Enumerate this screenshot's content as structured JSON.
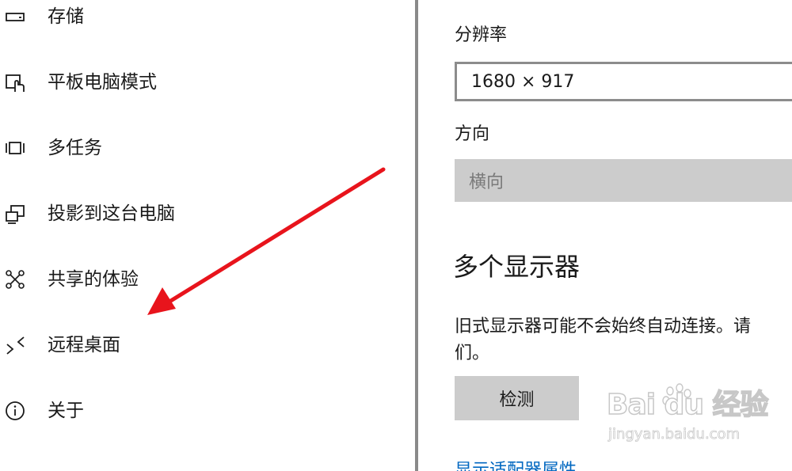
{
  "nav": {
    "items": [
      {
        "label": "存储",
        "icon": "storage-icon"
      },
      {
        "label": "平板电脑模式",
        "icon": "tablet-mode-icon"
      },
      {
        "label": "多任务",
        "icon": "multitasking-icon"
      },
      {
        "label": "投影到这台电脑",
        "icon": "project-to-pc-icon"
      },
      {
        "label": "共享的体验",
        "icon": "shared-experiences-icon"
      },
      {
        "label": "远程桌面",
        "icon": "remote-desktop-icon"
      },
      {
        "label": "关于",
        "icon": "info-icon"
      }
    ]
  },
  "display": {
    "resolution_label": "分辨率",
    "resolution_value": "1680 × 917",
    "orientation_label": "方向",
    "orientation_value": "横向",
    "multiple_displays_heading": "多个显示器",
    "multiple_displays_text_line1": "旧式显示器可能不会始终自动连接。请",
    "multiple_displays_text_line2": "们。",
    "detect_button": "检测",
    "adapter_link": "显示适配器属性"
  },
  "colors": {
    "annotation_arrow": "#e8141c",
    "link": "#0067c0",
    "disabled_fill": "#cccccc"
  },
  "watermark": {
    "brand": "Bai du 经验",
    "site": "jingyan.baidu.com"
  }
}
